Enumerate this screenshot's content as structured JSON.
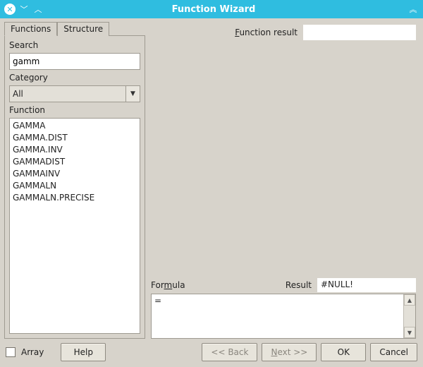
{
  "window": {
    "title": "Function Wizard"
  },
  "tabs": {
    "functions": "Functions",
    "structure": "Structure"
  },
  "left": {
    "search_label": "Search",
    "search_value": "gamm",
    "category_label": "Category",
    "category_value": "All",
    "function_label": "Function",
    "functions": [
      "GAMMA",
      "GAMMA.DIST",
      "GAMMA.INV",
      "GAMMADIST",
      "GAMMAINV",
      "GAMMALN",
      "GAMMALN.PRECISE"
    ]
  },
  "right": {
    "function_result_label": "Function result",
    "function_result_value": "",
    "formula_label": "Formula",
    "result_label": "Result",
    "result_value": "#NULL!",
    "formula_text": "="
  },
  "bottom": {
    "array_label": "Array",
    "help": "Help",
    "back": "<< Back",
    "next": "Next >>",
    "ok": "OK",
    "cancel": "Cancel"
  }
}
